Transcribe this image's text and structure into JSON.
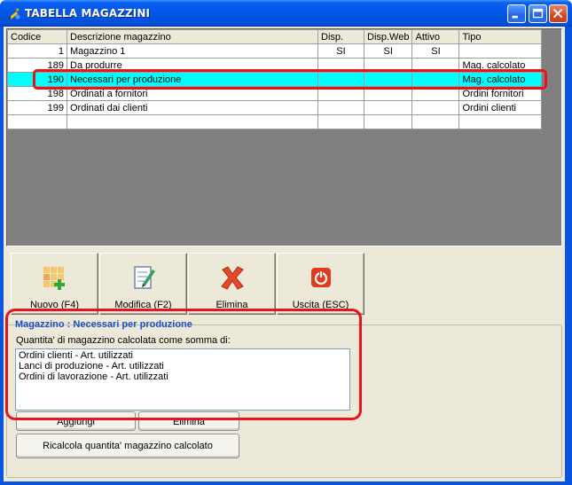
{
  "window": {
    "title": "TABELLA MAGAZZINI"
  },
  "grid": {
    "columns": [
      "Codice",
      "Descrizione magazzino",
      "Disp.",
      "Disp.Web",
      "Attivo",
      "Tipo"
    ],
    "rows": [
      {
        "codice": "1",
        "descrizione": "Magazzino 1",
        "disp": "SI",
        "disp_web": "SI",
        "attivo": "SI",
        "tipo": ""
      },
      {
        "codice": "189",
        "descrizione": "Da produrre",
        "disp": "",
        "disp_web": "",
        "attivo": "",
        "tipo": "Mag. calcolato"
      },
      {
        "codice": "190",
        "descrizione": "Necessari per produzione",
        "disp": "",
        "disp_web": "",
        "attivo": "",
        "tipo": "Mag. calcolato"
      },
      {
        "codice": "198",
        "descrizione": "Ordinati a fornitori",
        "disp": "",
        "disp_web": "",
        "attivo": "",
        "tipo": "Ordini fornitori"
      },
      {
        "codice": "199",
        "descrizione": "Ordinati dai clienti",
        "disp": "",
        "disp_web": "",
        "attivo": "",
        "tipo": "Ordini clienti"
      },
      {
        "codice": "",
        "descrizione": "",
        "disp": "",
        "disp_web": "",
        "attivo": "",
        "tipo": ""
      }
    ],
    "selected_row": 2,
    "highlight_color": "#00ffff"
  },
  "toolbar": {
    "nuovo_label": "Nuovo (F4)",
    "modifica_label": "Modifica (F2)",
    "elimina_label": "Elimina",
    "uscita_label": "Uscita (ESC)"
  },
  "detail": {
    "title": "Magazzino : Necessari per produzione",
    "subtitle": "Quantita' di magazzino calcolata come somma di:",
    "items": [
      "Ordini clienti - Art. utilizzati",
      "Lanci di produzione - Art. utilizzati",
      "Ordini di lavorazione - Art. utilizzati"
    ],
    "add_label": "Aggiungi",
    "delete_label": "Elimina",
    "recalc_label": "Ricalcola quantita' magazzino calcolato"
  },
  "colors": {
    "annotation_red": "#e8141b",
    "title_blue": "#1a4fcc"
  },
  "icons": {
    "title": "pencil-app-icon",
    "nuovo": "grid-add-icon",
    "modifica": "edit-document-icon",
    "elimina": "red-x-icon",
    "uscita": "power-icon"
  }
}
